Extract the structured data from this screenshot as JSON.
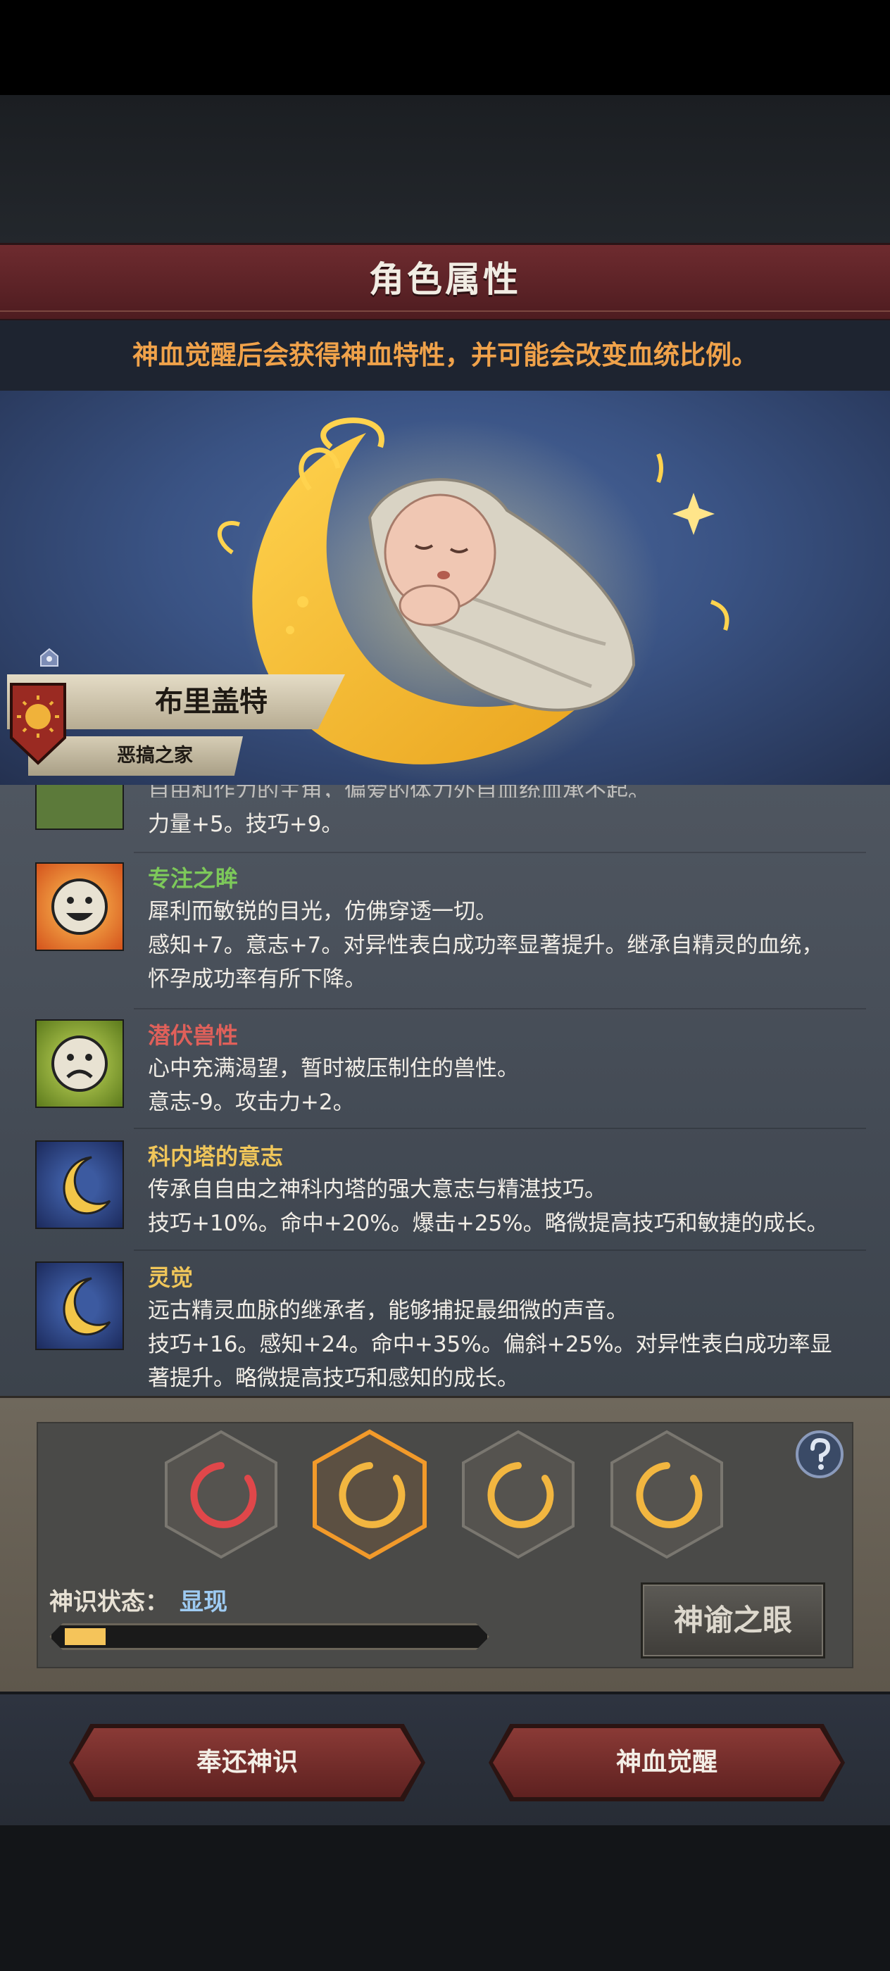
{
  "header": {
    "title": "角色属性",
    "notice": "神血觉醒后会获得神血特性，并可能会改变血统比例。"
  },
  "character": {
    "name": "布里盖特",
    "house": "恶搞之家"
  },
  "traits": {
    "partial_clipped": "自由和作力的主角，偏爱的体力外自血统血承不起。",
    "partial_stats": "力量+5。技巧+9。",
    "items": [
      {
        "name": "专注之眸",
        "name_color": "#7dc95a",
        "icon": "happy-face-icon",
        "line1": "犀利而敏锐的目光，仿佛穿透一切。",
        "line2": "感知+7。意志+7。对异性表白成功率显著提升。继承自精灵的血统，",
        "line3": "怀孕成功率有所下降。"
      },
      {
        "name": "潜伏兽性",
        "name_color": "#e0605a",
        "icon": "sad-face-icon",
        "line1": "心中充满渴望，暂时被压制住的兽性。",
        "line2": "意志-9。攻击力+2。",
        "line3": ""
      },
      {
        "name": "科内塔的意志",
        "name_color": "#f0c65a",
        "icon": "crescent-moon-icon",
        "line1": "传承自自由之神科内塔的强大意志与精湛技巧。",
        "line2": "技巧+10%。命中+20%。爆击+25%。略微提高技巧和敏捷的成长。",
        "line3": ""
      },
      {
        "name": "灵觉",
        "name_color": "#f0c65a",
        "icon": "crescent-moon-icon",
        "line1": "远古精灵血脉的继承者，能够捕捉最细微的声音。",
        "line2": "技巧+16。感知+24。命中+35%。偏斜+25%。对异性表白成功率显",
        "line3": "著提升。略微提高技巧和感知的成长。"
      }
    ]
  },
  "divine": {
    "status_label": "神识状态：",
    "status_value": "显现",
    "progress": 0.1,
    "oracle_button": "神谕之眼",
    "help_icon": "question-mark-icon",
    "slots": [
      {
        "color": "#e0474a",
        "selected": false
      },
      {
        "color": "#f2b640",
        "selected": true
      },
      {
        "color": "#f2b640",
        "selected": false
      },
      {
        "color": "#f2b640",
        "selected": false
      }
    ]
  },
  "actions": {
    "return_button": "奉还神识",
    "awaken_button": "神血觉醒"
  },
  "colors": {
    "title_banner": "#6e2b2f",
    "notice_text": "#f0a24a",
    "progress_fill": "#f5c45a"
  }
}
